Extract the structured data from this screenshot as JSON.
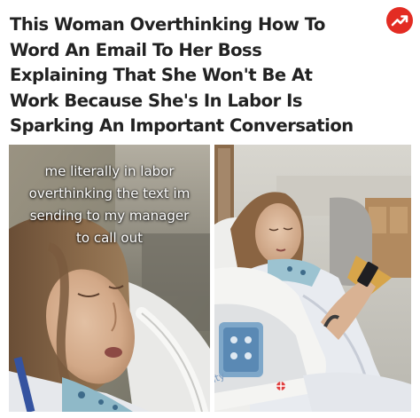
{
  "headline": {
    "lines": [
      "This Woman Overthinking How To",
      "Word An Email To Her Boss",
      "Explaining That She Won't Be At",
      "Work Because She's In Labor Is",
      "Sparking An Important Conversation"
    ]
  },
  "badge": {
    "icon": "trending-arrow-icon",
    "color": "#e32c23"
  },
  "left_photo": {
    "caption_lines": [
      "me literally in labor",
      "overthinking the text im",
      "sending to my manager",
      "to call out"
    ]
  },
  "right_photo": {
    "bed_label": "ssity"
  }
}
